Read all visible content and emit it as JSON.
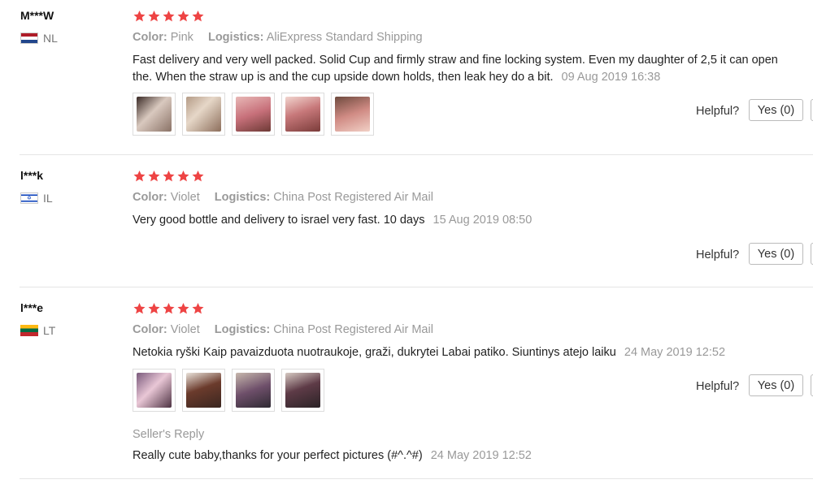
{
  "labels": {
    "color": "Color:",
    "logistics": "Logistics:",
    "helpful": "Helpful?",
    "seller_reply": "Seller's Reply"
  },
  "colors": {
    "star": "#ee4444",
    "muted": "#999999",
    "text": "#222222"
  },
  "reviews": [
    {
      "user": "M***W",
      "country": "NL",
      "flag_icon": "netherlands-flag-icon",
      "stars": 5,
      "color": "Pink",
      "logistics": "AliExpress Standard Shipping",
      "text": "Fast delivery and very well packed. Solid Cup and firmly straw and fine locking system. Even my daughter of 2,5 it can open the. When the straw up is and the cup upside down holds, then leak hey do a bit.",
      "date": "09 Aug 2019 16:38",
      "photos": 5,
      "yes_label": "Yes (0)"
    },
    {
      "user": "l***k",
      "country": "IL",
      "flag_icon": "israel-flag-icon",
      "stars": 5,
      "color": "Violet",
      "logistics": "China Post Registered Air Mail",
      "text": "Very good bottle and delivery to israel very fast. 10 days",
      "date": "15 Aug 2019 08:50",
      "photos": 0,
      "yes_label": "Yes (0)"
    },
    {
      "user": "l***e",
      "country": "LT",
      "flag_icon": "lithuania-flag-icon",
      "stars": 5,
      "color": "Violet",
      "logistics": "China Post Registered Air Mail",
      "text": "Netokia ryški Kaip pavaizduota nuotraukoje, graži, dukrytei Labai patiko. Siuntinys atejo laiku",
      "date": "24 May 2019 12:52",
      "photos": 4,
      "yes_label": "Yes (0)",
      "seller_reply": {
        "text": "Really cute baby,thanks for your perfect pictures (#^.^#)",
        "date": "24 May 2019 12:52"
      }
    }
  ]
}
